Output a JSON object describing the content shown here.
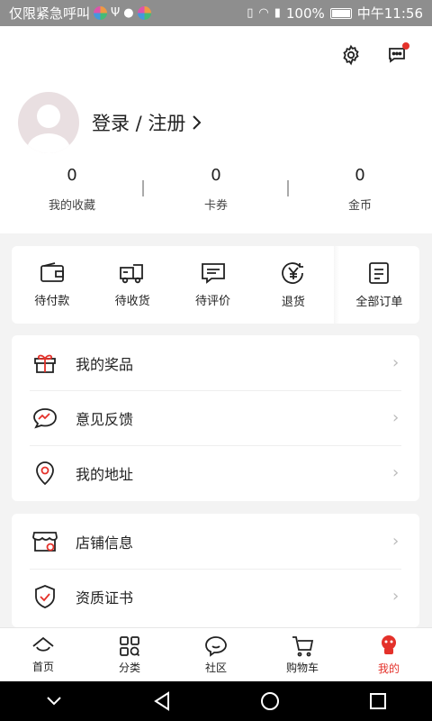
{
  "status_bar": {
    "left_text": "仅限紧急呼叫",
    "battery": "100%",
    "time": "中午11:56"
  },
  "header": {
    "login_label": "登录 / 注册",
    "stats": [
      {
        "value": "0",
        "label": "我的收藏"
      },
      {
        "value": "0",
        "label": "卡券"
      },
      {
        "value": "0",
        "label": "金币"
      }
    ]
  },
  "orders": [
    {
      "label": "待付款",
      "icon": "wallet-icon"
    },
    {
      "label": "待收货",
      "icon": "truck-icon"
    },
    {
      "label": "待评价",
      "icon": "comment-icon"
    },
    {
      "label": "退货",
      "icon": "yen-return-icon"
    },
    {
      "label": "全部订单",
      "icon": "order-list-icon"
    }
  ],
  "menu1": [
    {
      "label": "我的奖品",
      "icon": "gift-icon"
    },
    {
      "label": "意见反馈",
      "icon": "feedback-icon"
    },
    {
      "label": "我的地址",
      "icon": "location-icon"
    }
  ],
  "menu2": [
    {
      "label": "店铺信息",
      "icon": "store-icon"
    },
    {
      "label": "资质证书",
      "icon": "certificate-icon"
    }
  ],
  "bottom_nav": [
    {
      "label": "首页",
      "icon": "home-icon"
    },
    {
      "label": "分类",
      "icon": "category-icon"
    },
    {
      "label": "社区",
      "icon": "community-icon"
    },
    {
      "label": "购物车",
      "icon": "cart-icon"
    },
    {
      "label": "我的",
      "icon": "profile-icon"
    }
  ],
  "colors": {
    "accent": "#e4312a",
    "statusbar": "#8e8e8e",
    "background": "#f3f3f3"
  }
}
